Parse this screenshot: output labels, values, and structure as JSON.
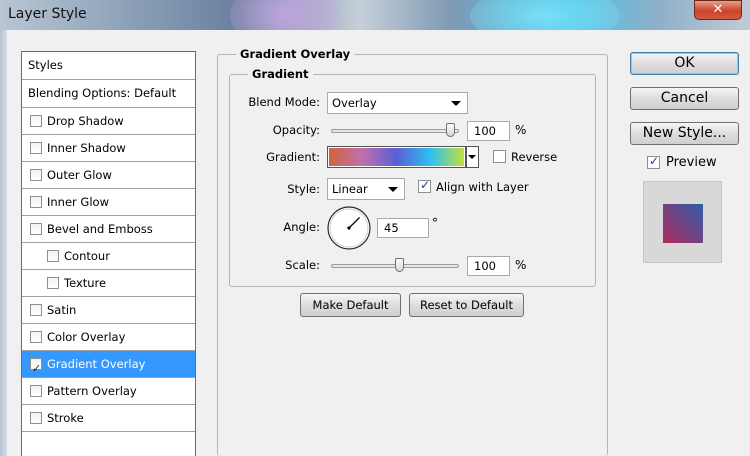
{
  "window": {
    "title": "Layer Style",
    "close_glyph": "✕"
  },
  "styles_panel": {
    "header": "Styles",
    "blending": "Blending Options: Default",
    "items": [
      {
        "label": "Drop Shadow",
        "checked": false
      },
      {
        "label": "Inner Shadow",
        "checked": false
      },
      {
        "label": "Outer Glow",
        "checked": false
      },
      {
        "label": "Inner Glow",
        "checked": false
      },
      {
        "label": "Bevel and Emboss",
        "checked": false
      },
      {
        "label": "Contour",
        "checked": false
      },
      {
        "label": "Texture",
        "checked": false
      },
      {
        "label": "Satin",
        "checked": false
      },
      {
        "label": "Color Overlay",
        "checked": false
      },
      {
        "label": "Gradient Overlay",
        "checked": true,
        "selected": true
      },
      {
        "label": "Pattern Overlay",
        "checked": false
      },
      {
        "label": "Stroke",
        "checked": false
      }
    ]
  },
  "gradient_overlay": {
    "section_title": "Gradient Overlay",
    "group_title": "Gradient",
    "blend_mode": {
      "label": "Blend Mode:",
      "value": "Overlay"
    },
    "opacity": {
      "label": "Opacity:",
      "value": "100",
      "unit": "%",
      "level": 100
    },
    "gradient": {
      "label": "Gradient:",
      "colors": [
        "#d2643a",
        "#c06fae",
        "#5a5fd6",
        "#2ec1f0",
        "#c8e036"
      ]
    },
    "reverse": {
      "label": "Reverse",
      "checked": false
    },
    "style": {
      "label": "Style:",
      "value": "Linear"
    },
    "align_with_layer": {
      "label": "Align with Layer",
      "checked": true
    },
    "angle": {
      "label": "Angle:",
      "value": "45",
      "unit": "°",
      "degrees": 45
    },
    "scale": {
      "label": "Scale:",
      "value": "100",
      "unit": "%",
      "level": 100
    },
    "make_default": "Make Default",
    "reset_to_default": "Reset to Default"
  },
  "actions": {
    "ok": "OK",
    "cancel": "Cancel",
    "new_style": "New Style...",
    "preview": {
      "label": "Preview",
      "checked": true
    }
  },
  "colors": {
    "selection": "#3399ff",
    "preview_from": "#2f5ea8",
    "preview_to": "#b02a5e"
  }
}
